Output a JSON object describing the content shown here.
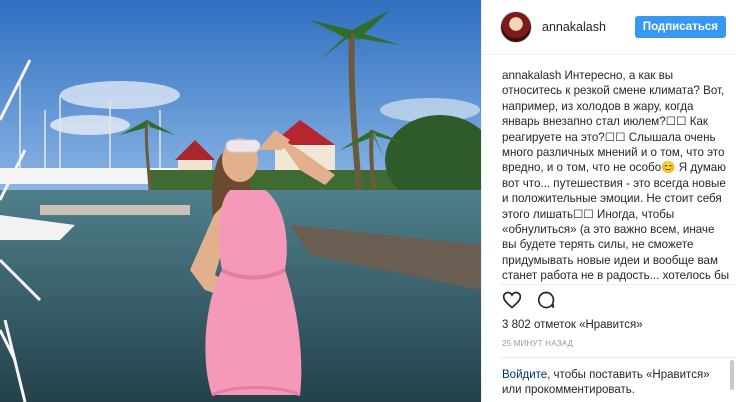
{
  "post": {
    "username": "annakalash",
    "follow_label": "Подписаться",
    "caption_user": "annakalash",
    "caption_text": " Интересно, а как вы относитесь к резкой смене климата? Вот, например, из холодов в жару, когда январь внезапно стал июлем?☐☐ Как реагируете на это?☐☐ Слышала очень много различных мнений и о том, что это вредно, и о том, что не особо😊 Я думаю вот что... путешествия - это всегда новые и положительные эмоции. Не стоит себя этого лишать☐☐ Иногда, чтобы «обнулиться» (а это важно всем, иначе вы будете терять силы, не сможете придумывать новые идеи и вообще вам станет работа не в радость... хотелось бы верить, что она вам в",
    "likes": "3 802 отметок «Нравится»",
    "time": "25 МИНУТ НАЗАД",
    "login_link": "Войдите",
    "login_text": ", чтобы поставить «Нравится» или прокомментировать."
  },
  "icons": {
    "like": "heart-icon",
    "comment": "comment-icon"
  },
  "colors": {
    "follow_button": "#3897f0",
    "link": "#003569",
    "dress": "#f49ab8"
  }
}
